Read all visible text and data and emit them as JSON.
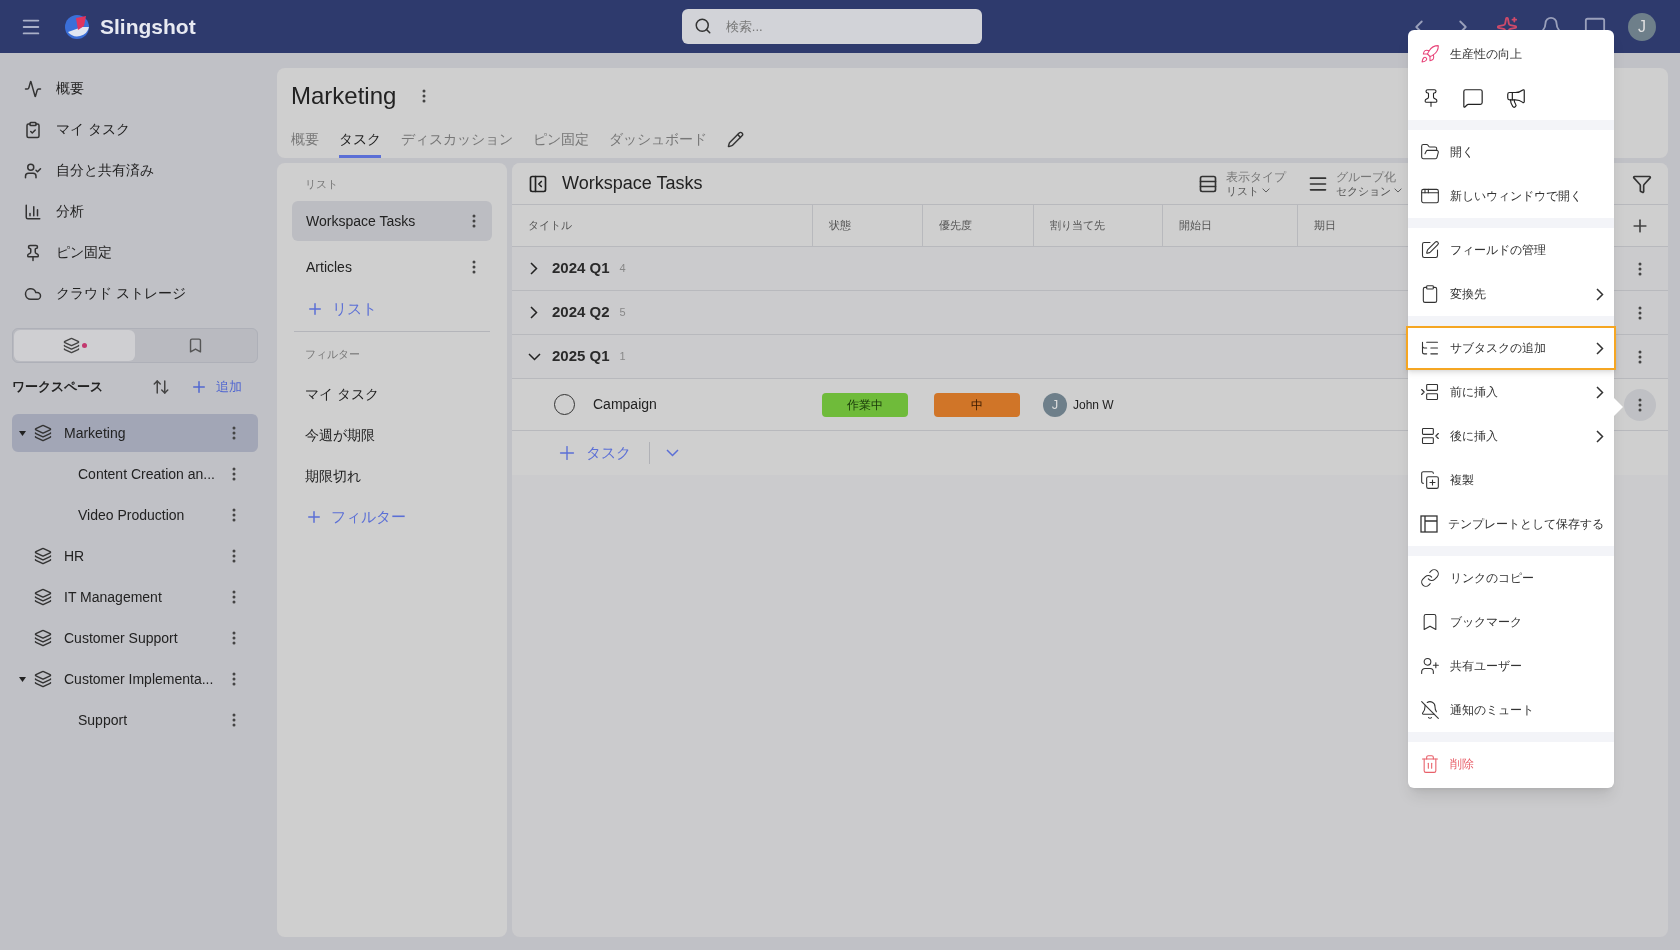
{
  "app": {
    "name": "Slingshot"
  },
  "search": {
    "placeholder": "検索..."
  },
  "user": {
    "initial": "J"
  },
  "nav": [
    {
      "label": "概要"
    },
    {
      "label": "マイ タスク"
    },
    {
      "label": "自分と共有済み"
    },
    {
      "label": "分析"
    },
    {
      "label": "ピン固定"
    },
    {
      "label": "クラウド ストレージ"
    }
  ],
  "sidebar_tabs": [
    {
      "selected": true
    },
    {
      "selected": false
    }
  ],
  "workspace_header": {
    "title": "ワークスペース",
    "add": "追加"
  },
  "workspaces": [
    {
      "name": "Marketing",
      "selected": true,
      "expanded": true,
      "children": [
        {
          "name": "Content Creation an...",
          "selected": false
        },
        {
          "name": "Video Production",
          "selected": false
        }
      ]
    },
    {
      "name": "HR",
      "selected": false
    },
    {
      "name": "IT Management",
      "selected": false
    },
    {
      "name": "Customer Support",
      "selected": false
    },
    {
      "name": "Customer Implementa...",
      "selected": false,
      "expanded": true,
      "children": [
        {
          "name": "Support",
          "selected": false
        }
      ]
    }
  ],
  "project": {
    "title": "Marketing",
    "tabs": [
      {
        "label": "概要",
        "selected": false
      },
      {
        "label": "タスク",
        "selected": true
      },
      {
        "label": "ディスカッション",
        "selected": false
      },
      {
        "label": "ピン固定",
        "selected": false
      },
      {
        "label": "ダッシュボード",
        "selected": false
      }
    ]
  },
  "lists": {
    "heading": "リスト",
    "items": [
      {
        "label": "Workspace Tasks",
        "selected": true
      },
      {
        "label": "Articles",
        "selected": false
      }
    ],
    "add": "リスト"
  },
  "filters": {
    "heading": "フィルター",
    "items": [
      {
        "label": "マイ タスク"
      },
      {
        "label": "今週が期限"
      },
      {
        "label": "期限切れ"
      }
    ],
    "add": "フィルター"
  },
  "table": {
    "title": "Workspace Tasks",
    "view": {
      "label": "表示タイプ",
      "value": "リスト"
    },
    "group": {
      "label": "グループ化",
      "value": "セクション"
    },
    "columns": [
      "タイトル",
      "状態",
      "優先度",
      "割り当て先",
      "開始日",
      "期日"
    ],
    "groups": [
      {
        "name": "2024 Q1",
        "count": "4",
        "expanded": false
      },
      {
        "name": "2024 Q2",
        "count": "5",
        "expanded": false
      },
      {
        "name": "2025 Q1",
        "count": "1",
        "expanded": true,
        "tasks": [
          {
            "title": "Campaign",
            "checked": false,
            "status": {
              "label": "作業中",
              "color": "#6fbb3a"
            },
            "priority": {
              "label": "中",
              "color": "#d07528"
            },
            "assignee": {
              "initial": "J",
              "name": "John W"
            }
          }
        ]
      }
    ],
    "add_task": "タスク"
  },
  "context_menu": {
    "sections": [
      [
        {
          "kind": "item",
          "label": "生産性の向上",
          "submenu": false,
          "selected": false
        },
        {
          "kind": "icon_row"
        }
      ],
      [
        {
          "kind": "item",
          "label": "開く",
          "submenu": false,
          "selected": false
        },
        {
          "kind": "item",
          "label": "新しいウィンドウで開く",
          "submenu": false,
          "selected": false
        }
      ],
      [
        {
          "kind": "item",
          "label": "フィールドの管理",
          "submenu": false,
          "selected": false
        },
        {
          "kind": "item",
          "label": "変換先",
          "submenu": true,
          "selected": false
        }
      ],
      [
        {
          "kind": "item",
          "label": "サブタスクの追加",
          "submenu": true,
          "selected": true
        },
        {
          "kind": "item",
          "label": "前に挿入",
          "submenu": true,
          "selected": false
        },
        {
          "kind": "item",
          "label": "後に挿入",
          "submenu": true,
          "selected": false
        },
        {
          "kind": "item",
          "label": "複製",
          "submenu": false,
          "selected": false
        },
        {
          "kind": "item",
          "label": "テンプレートとして保存する",
          "submenu": false,
          "selected": false
        }
      ],
      [
        {
          "kind": "item",
          "label": "リンクのコピー",
          "submenu": false,
          "selected": false
        },
        {
          "kind": "item",
          "label": "ブックマーク",
          "submenu": false,
          "selected": false
        },
        {
          "kind": "item",
          "label": "共有ユーザー",
          "submenu": false,
          "selected": false
        },
        {
          "kind": "item",
          "label": "通知のミュート",
          "submenu": false,
          "selected": false
        }
      ],
      [
        {
          "kind": "danger",
          "label": "削除",
          "submenu": false,
          "selected": false
        }
      ]
    ]
  }
}
